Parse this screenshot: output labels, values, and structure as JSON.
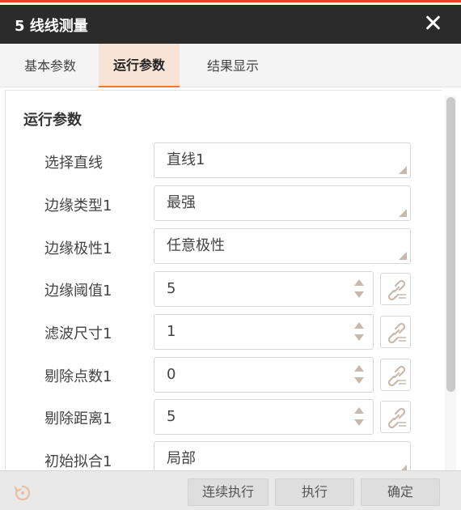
{
  "window": {
    "title": "5 线线测量"
  },
  "tabs": [
    {
      "label": "基本参数"
    },
    {
      "label": "运行参数"
    },
    {
      "label": "结果显示"
    }
  ],
  "active_tab": "运行参数",
  "section": {
    "title": "运行参数"
  },
  "params": [
    {
      "label": "选择直线",
      "value": "直线1",
      "kind": "select"
    },
    {
      "label": "边缘类型1",
      "value": "最强",
      "kind": "select"
    },
    {
      "label": "边缘极性1",
      "value": "任意极性",
      "kind": "select"
    },
    {
      "label": "边缘阈值1",
      "value": "5",
      "kind": "spin"
    },
    {
      "label": "滤波尺寸1",
      "value": "1",
      "kind": "spin"
    },
    {
      "label": "剔除点数1",
      "value": "0",
      "kind": "spin"
    },
    {
      "label": "剔除距离1",
      "value": "5",
      "kind": "spin"
    },
    {
      "label": "初始拟合1",
      "value": "局部",
      "kind": "select"
    }
  ],
  "footer": {
    "continuous_label": "连续执行",
    "run_label": "执行",
    "ok_label": "确定"
  },
  "icons": {
    "close": "close-icon",
    "link": "link-icon",
    "refresh": "refresh-icon"
  },
  "colors": {
    "accent": "#e87a3a",
    "titlebar": "#2b2b2b",
    "topline": "#e8412c",
    "icon": "#c9b9ad"
  }
}
